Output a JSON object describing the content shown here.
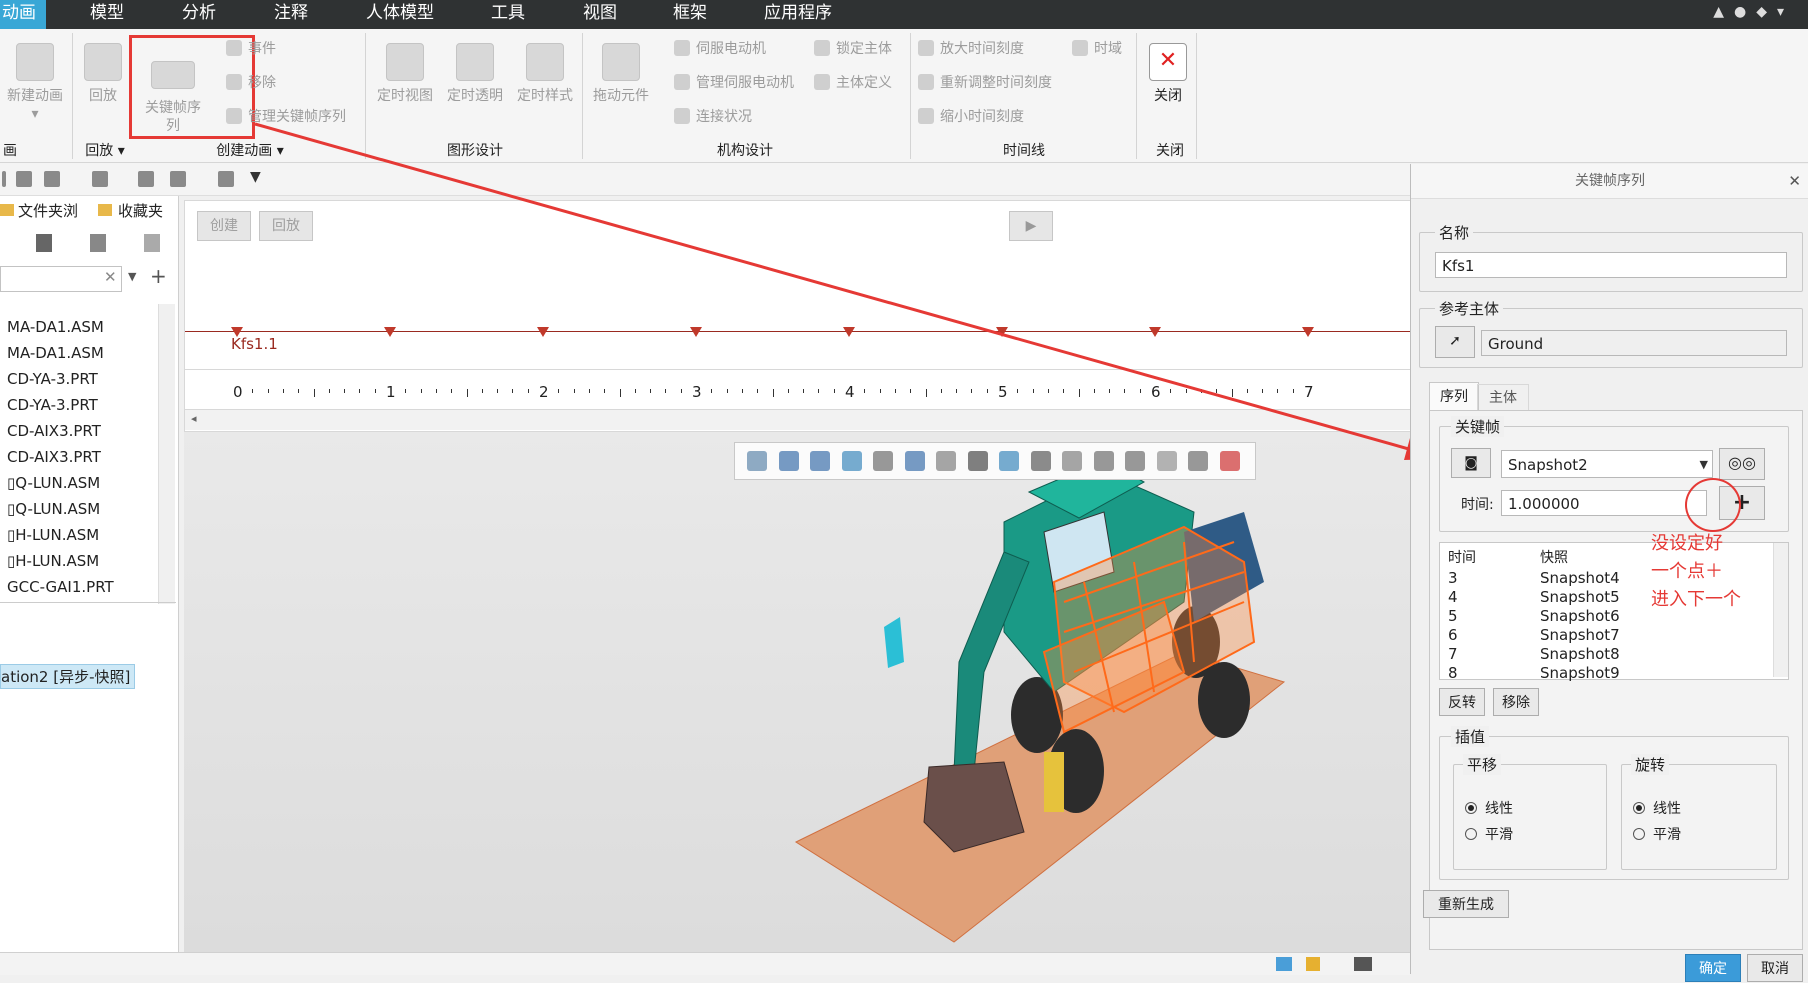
{
  "menu": {
    "tabs": [
      "动画",
      "模型",
      "分析",
      "注释",
      "人体模型",
      "工具",
      "视图",
      "框架",
      "应用程序"
    ],
    "active": "动画"
  },
  "ribbon": {
    "new_animation": "新建动画",
    "playback": "回放",
    "keyframe_seq": "关键帧序\n列",
    "events": "事件",
    "remove": "移除",
    "manage_keyframes": "管理关键帧序列",
    "timed_view": "定时视图",
    "timed_transparency": "定时透明",
    "timed_style": "定时样式",
    "drag_component": "拖动元件",
    "servo_motor": "伺服电动机",
    "manage_servo": "管理伺服电动机",
    "connection_status": "连接状况",
    "lock_body": "锁定主体",
    "body_definition": "主体定义",
    "zoom_in_time": "放大时间刻度",
    "readjust_time": "重新调整时间刻度",
    "zoom_out_time": "缩小时间刻度",
    "time_domain": "时域",
    "close": "关闭",
    "groups": {
      "animation": "画",
      "playback": "回放",
      "create_animation": "创建动画",
      "graphic_design": "图形设计",
      "mechanism_design": "机构设计",
      "timeline": "时间线",
      "close": "关闭"
    }
  },
  "left_panel": {
    "tab_folder": "文件夹浏",
    "tab_favorites": "收藏夹",
    "tree_items": [
      "MA-DA1.ASM",
      "MA-DA1.ASM",
      "CD-YA-3.PRT",
      "CD-YA-3.PRT",
      "CD-AIX3.PRT",
      "CD-AIX3.PRT",
      "▯Q-LUN.ASM",
      "▯Q-LUN.ASM",
      "▯H-LUN.ASM",
      "▯H-LUN.ASM",
      "GCC-GAI1.PRT"
    ],
    "selected_item": "ation2 [异步-快照]"
  },
  "timeline": {
    "create": "创建",
    "playback": "回放",
    "track_label": "Kfs1.1",
    "ticks": [
      "0",
      "1",
      "2",
      "3",
      "4",
      "5",
      "6",
      "7"
    ],
    "keyframe_times": [
      0,
      1,
      2,
      3,
      4,
      5,
      6,
      7
    ]
  },
  "dialog": {
    "title": "关键帧序列",
    "name_label": "名称",
    "name_value": "Kfs1",
    "ref_body_label": "参考主体",
    "ref_body_value": "Ground",
    "tab_sequence": "序列",
    "tab_body": "主体",
    "keyframe_label": "关键帧",
    "snapshot_value": "Snapshot2",
    "time_label": "时间:",
    "time_value": "1.000000",
    "col_time": "时间",
    "col_snapshot": "快照",
    "rows": [
      {
        "time": "3",
        "snap": "Snapshot4"
      },
      {
        "time": "4",
        "snap": "Snapshot5"
      },
      {
        "time": "5",
        "snap": "Snapshot6"
      },
      {
        "time": "6",
        "snap": "Snapshot7"
      },
      {
        "time": "7",
        "snap": "Snapshot8"
      },
      {
        "time": "8",
        "snap": "Snapshot9"
      }
    ],
    "reverse": "反转",
    "remove": "移除",
    "interp_label": "插值",
    "translation_label": "平移",
    "rotation_label": "旋转",
    "linear": "线性",
    "smooth": "平滑",
    "regenerate": "重新生成",
    "ok": "确定",
    "cancel": "取消",
    "annotation": "没设定好\n一个点＋\n进入下一个"
  },
  "colors": {
    "accent": "#39a7d6",
    "annotation_red": "#e53935",
    "timeline_red": "#c0392b",
    "orange_frame": "#ff6a1a",
    "teal_body": "#1aa08a"
  }
}
